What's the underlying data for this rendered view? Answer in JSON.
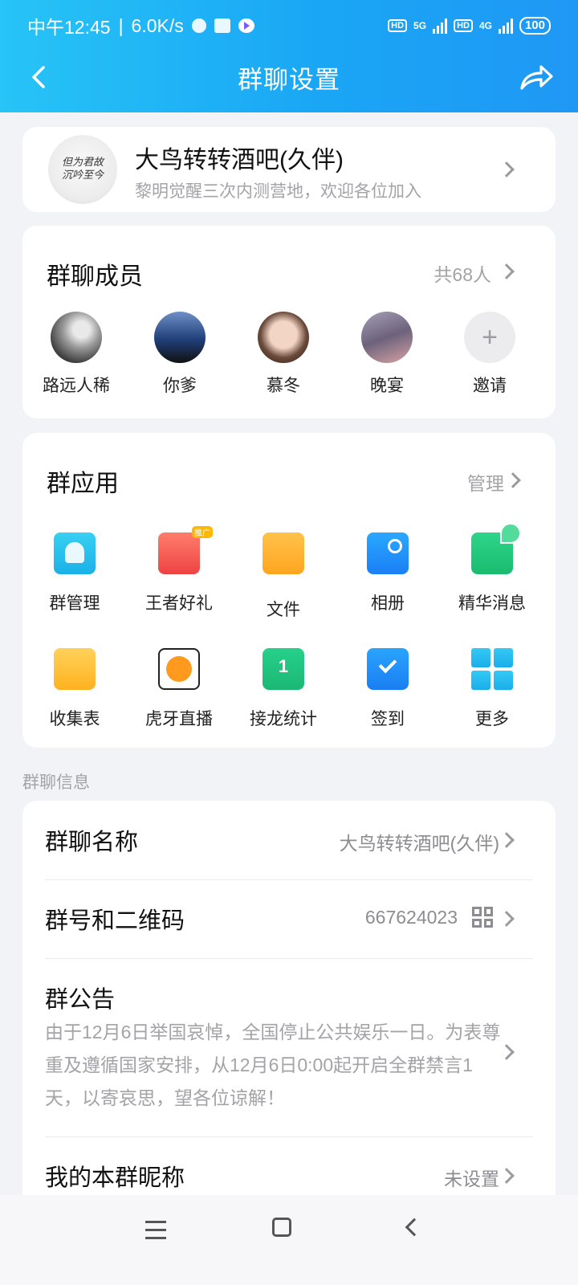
{
  "status_bar": {
    "time": "中午12:45",
    "speed": "6.0K/s",
    "network1": "5G",
    "network2": "4G",
    "hd": "HD",
    "battery": "100"
  },
  "nav": {
    "title": "群聊设置"
  },
  "group": {
    "name": "大鸟转转酒吧(久伴)",
    "description": "黎明觉醒三次内测营地，欢迎各位加入",
    "avatar_text": "但为君故\n沉吟至今"
  },
  "members": {
    "title": "群聊成员",
    "count": "共68人",
    "list": [
      {
        "name": "路远人稀"
      },
      {
        "name": "你爹"
      },
      {
        "name": "慕冬"
      },
      {
        "name": "晚宴"
      }
    ],
    "invite_label": "邀请"
  },
  "apps": {
    "title": "群应用",
    "manage_label": "管理",
    "items": [
      {
        "label": "群管理"
      },
      {
        "label": "王者好礼"
      },
      {
        "label": "文件"
      },
      {
        "label": "相册"
      },
      {
        "label": "精华消息"
      },
      {
        "label": "收集表"
      },
      {
        "label": "虎牙直播"
      },
      {
        "label": "接龙统计"
      },
      {
        "label": "签到"
      },
      {
        "label": "更多"
      }
    ],
    "promo_badge": "推广"
  },
  "info": {
    "section_label": "群聊信息",
    "group_name_title": "群聊名称",
    "group_name_value": "大鸟转转酒吧(久伴)",
    "group_id_title": "群号和二维码",
    "group_id_value": "667624023",
    "notice_title": "群公告",
    "notice_text": "由于12月6日举国哀悼，全国停止公共娱乐一日。为表尊重及遵循国家安排，从12月6日0:00起开启全群禁言1天，以寄哀思，望各位谅解！",
    "nickname_title": "我的本群昵称",
    "nickname_value": "未设置"
  },
  "colors": {
    "header_start": "#27c4f7",
    "header_end": "#1f98f5",
    "background": "#f2f3f7"
  }
}
